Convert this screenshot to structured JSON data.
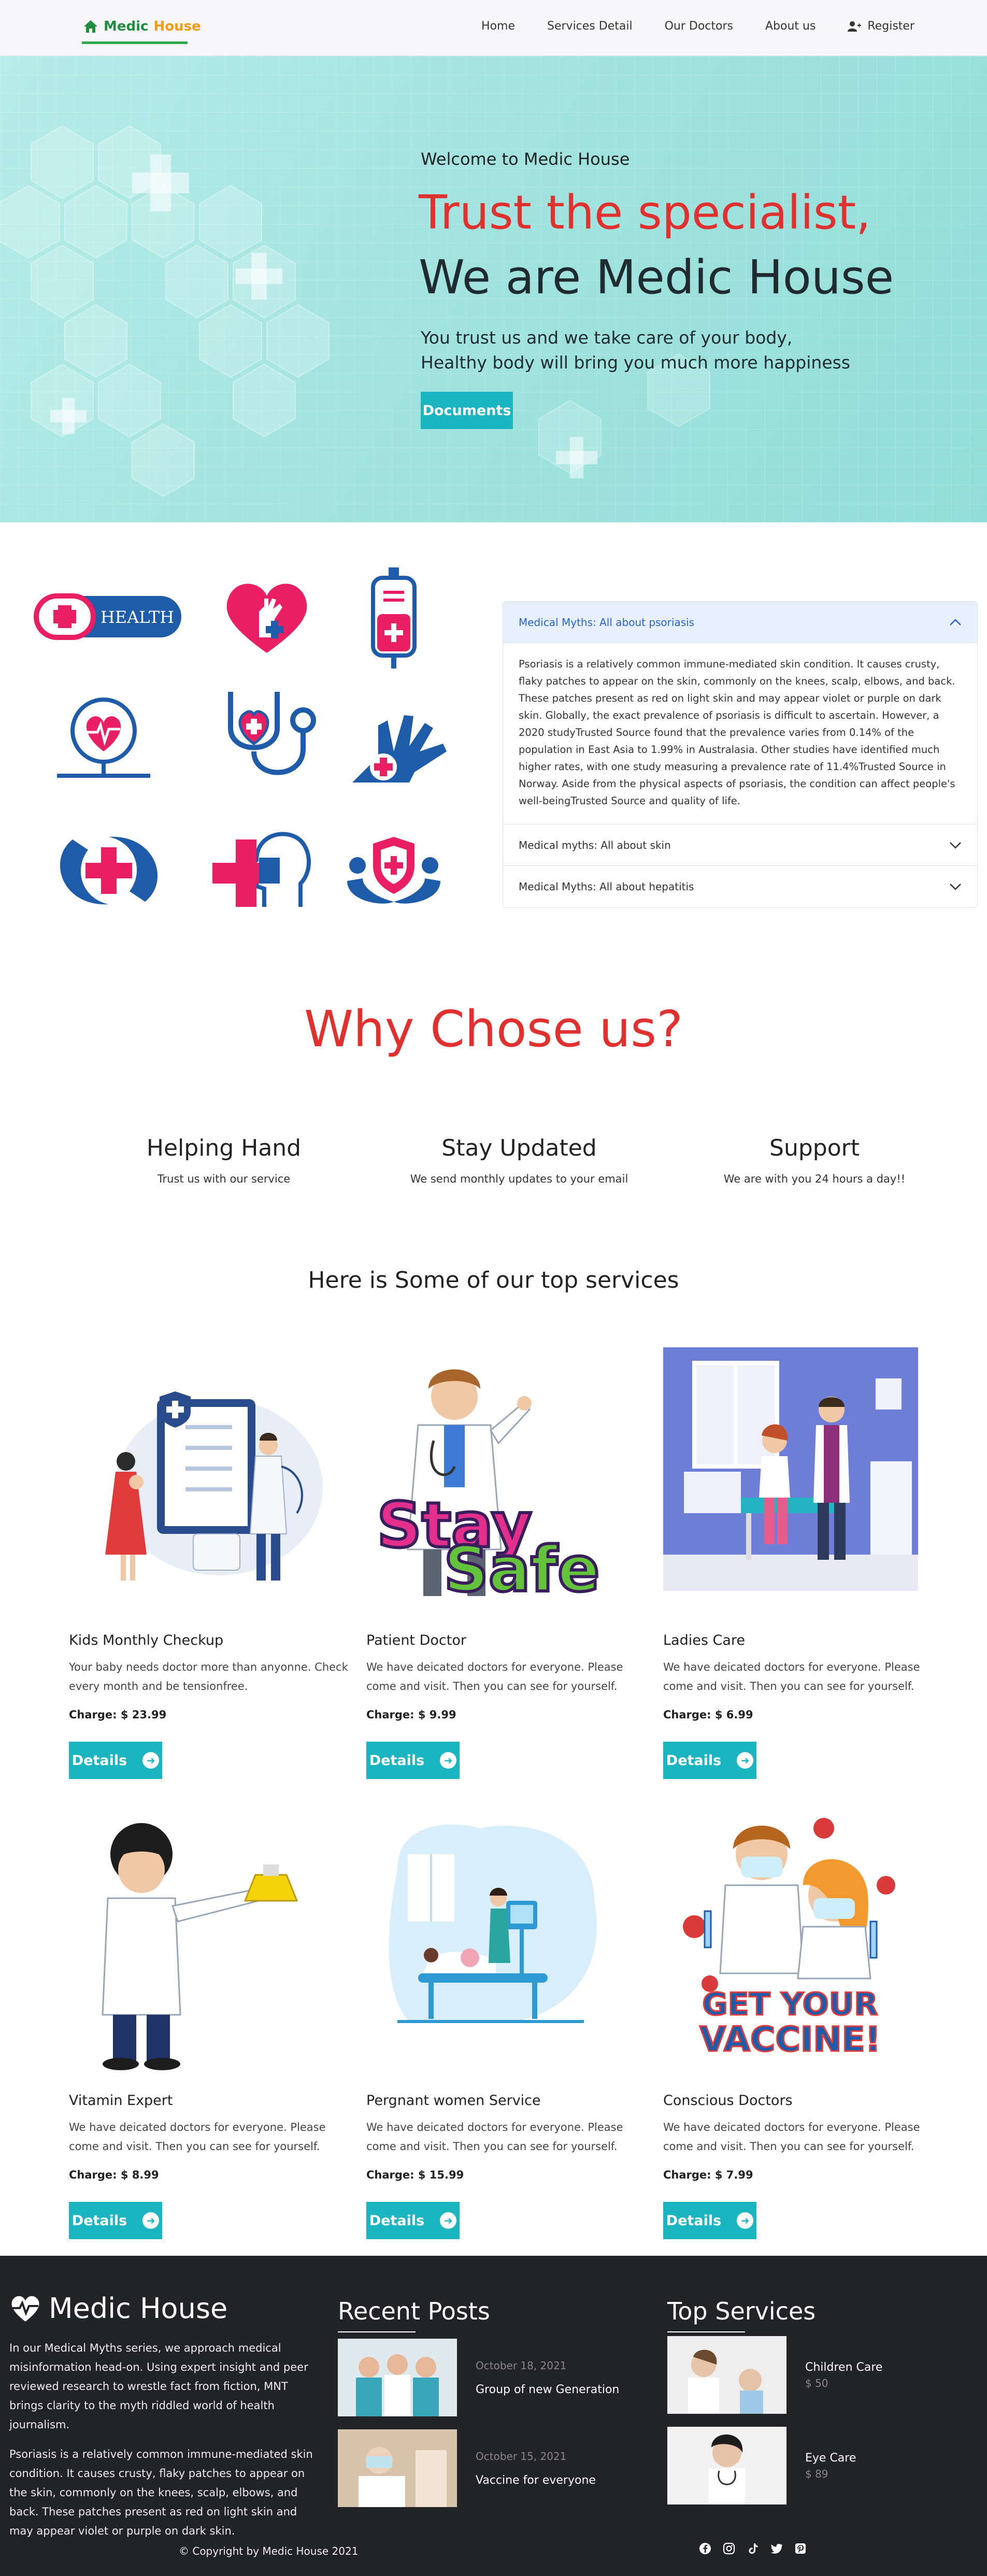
{
  "nav": {
    "brand_part1": "Medic",
    "brand_part2": "House",
    "links": [
      "Home",
      "Services Detail",
      "Our Doctors",
      "About us",
      "Register"
    ]
  },
  "hero": {
    "welcome": "Welcome to Medic House",
    "title_line1": "Trust the specialist,",
    "title_line2": "We are Medic House",
    "text_line1": "You trust us and we take care of your body,",
    "text_line2": "Healthy body will bring you much more happiness",
    "button": "Documents"
  },
  "icons": {
    "health_label": "HEALTH"
  },
  "accordion": {
    "items": [
      {
        "title": "Medical Myths: All about psoriasis",
        "open": true,
        "body": "Psoriasis is a relatively common immune-mediated skin condition. It causes crusty, flaky patches to appear on the skin, commonly on the knees, scalp, elbows, and back. These patches present as red on light skin and may appear violet or purple on dark skin. Globally, the exact prevalence of psoriasis is difficult to ascertain. However, a 2020 studyTrusted Source found that the prevalence varies from 0.14% of the population in East Asia to 1.99% in Australasia. Other studies have identified much higher rates, with one study measuring a prevalence rate of 11.4%Trusted Source in Norway. Aside from the physical aspects of psoriasis, the condition can affect people's well-beingTrusted Source and quality of life."
      },
      {
        "title": "Medical myths: All about skin",
        "open": false
      },
      {
        "title": "Medical Myths: All about hepatitis",
        "open": false
      }
    ]
  },
  "why": {
    "title": "Why Chose us?",
    "columns": [
      {
        "title": "Helping Hand",
        "text": "Trust us with our service"
      },
      {
        "title": "Stay Updated",
        "text": "We send monthly updates to your email"
      },
      {
        "title": "Support",
        "text": "We are with you 24 hours a day!!"
      }
    ]
  },
  "services": {
    "title": "Here is Some of our top services",
    "details_label": "Details",
    "cards": [
      {
        "name": "Kids Monthly Checkup",
        "desc": "Your baby needs doctor more than anyonne. Check every month and be tensionfree.",
        "charge": "Charge: $ 23.99"
      },
      {
        "name": "Patient Doctor",
        "desc": "We have deicated doctors for everyone. Please come and visit. Then you can see for yourself.",
        "charge": "Charge: $ 9.99"
      },
      {
        "name": "Ladies Care",
        "desc": "We have deicated doctors for everyone. Please come and visit. Then you can see for yourself.",
        "charge": "Charge: $ 6.99"
      },
      {
        "name": "Vitamin Expert",
        "desc": "We have deicated doctors for everyone. Please come and visit. Then you can see for yourself.",
        "charge": "Charge: $ 8.99"
      },
      {
        "name": "Pergnant women Service",
        "desc": "We have deicated doctors for everyone. Please come and visit. Then you can see for yourself.",
        "charge": "Charge: $ 15.99"
      },
      {
        "name": "Conscious Doctors",
        "desc": "We have deicated doctors for everyone. Please come and visit. Then you can see for yourself.",
        "charge": "Charge: $ 7.99"
      }
    ],
    "stay_safe_line1": "Stay",
    "stay_safe_line2": "Safe",
    "vaccine_line1": "GET YOUR",
    "vaccine_line2": "VACCINE!"
  },
  "footer": {
    "brand": "Medic House",
    "text1": "In our Medical Myths series, we approach medical misinformation head-on. Using expert insight and peer reviewed research to wrestle fact from fiction, MNT brings clarity to the myth riddled world of health journalism.",
    "text2": "Psoriasis is a relatively common immune-mediated skin condition. It causes crusty, flaky patches to appear on the skin, commonly on the knees, scalp, elbows, and back. These patches present as red on light skin and may appear violet or purple on dark skin.",
    "recent_title": "Recent Posts",
    "posts": [
      {
        "date": "October 18, 2021",
        "title": "Group of new Generation"
      },
      {
        "date": "October 15, 2021",
        "title": "Vaccine for everyone"
      }
    ],
    "top_title": "Top Services",
    "top_services": [
      {
        "title": "Children Care",
        "price": "$ 50"
      },
      {
        "title": "Eye Care",
        "price": "$ 89"
      }
    ],
    "copyright": "© Copyright by Medic House 2021",
    "social_icons": [
      "facebook-icon",
      "instagram-icon",
      "tiktok-icon",
      "twitter-icon",
      "pinterest-icon"
    ]
  },
  "colors": {
    "accent": "#1bb5c2",
    "headline_red": "#e0312f",
    "brand_green": "#1e8e3e",
    "brand_orange": "#f39c12",
    "footer_bg": "#222326"
  }
}
